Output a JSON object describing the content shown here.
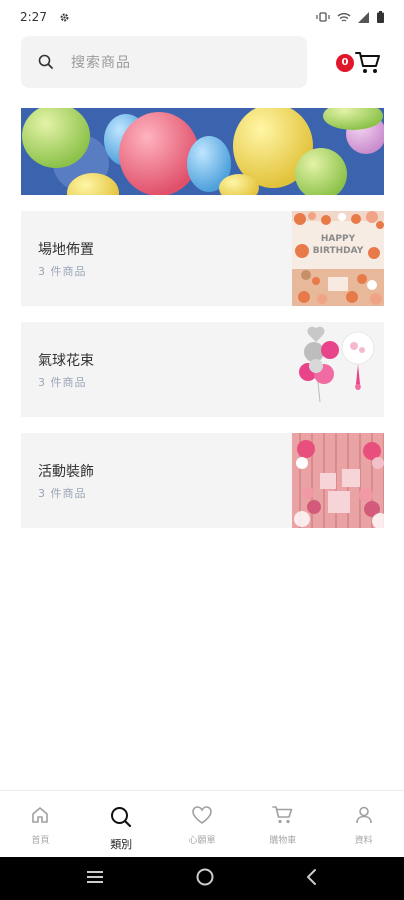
{
  "status_bar": {
    "time": "2:27",
    "icons": [
      "settings-icon",
      "vibrate-icon",
      "wifi-icon",
      "signal-icon",
      "battery-icon"
    ]
  },
  "search": {
    "placeholder": "搜索商品"
  },
  "cart": {
    "badge_count": "0"
  },
  "banner": {
    "alt": "balloons-banner"
  },
  "categories": [
    {
      "name": "場地佈置",
      "count": "3 件商品",
      "thumb": "birthday-decoration"
    },
    {
      "name": "氣球花束",
      "count": "3 件商品",
      "thumb": "balloon-bouquet"
    },
    {
      "name": "活動裝飾",
      "count": "3 件商品",
      "thumb": "event-decoration"
    }
  ],
  "tabs": [
    {
      "label": "首頁",
      "icon": "home-icon",
      "active": false
    },
    {
      "label": "類別",
      "icon": "search-icon",
      "active": true
    },
    {
      "label": "心願單",
      "icon": "heart-icon",
      "active": false
    },
    {
      "label": "購物車",
      "icon": "cart-icon",
      "active": false
    },
    {
      "label": "資料",
      "icon": "user-icon",
      "active": false
    }
  ],
  "colors": {
    "badge": "#e0172b",
    "banner_sky": "#3c63ad",
    "card_bg": "#f4f4f4",
    "muted_text": "#9aa5b8"
  }
}
